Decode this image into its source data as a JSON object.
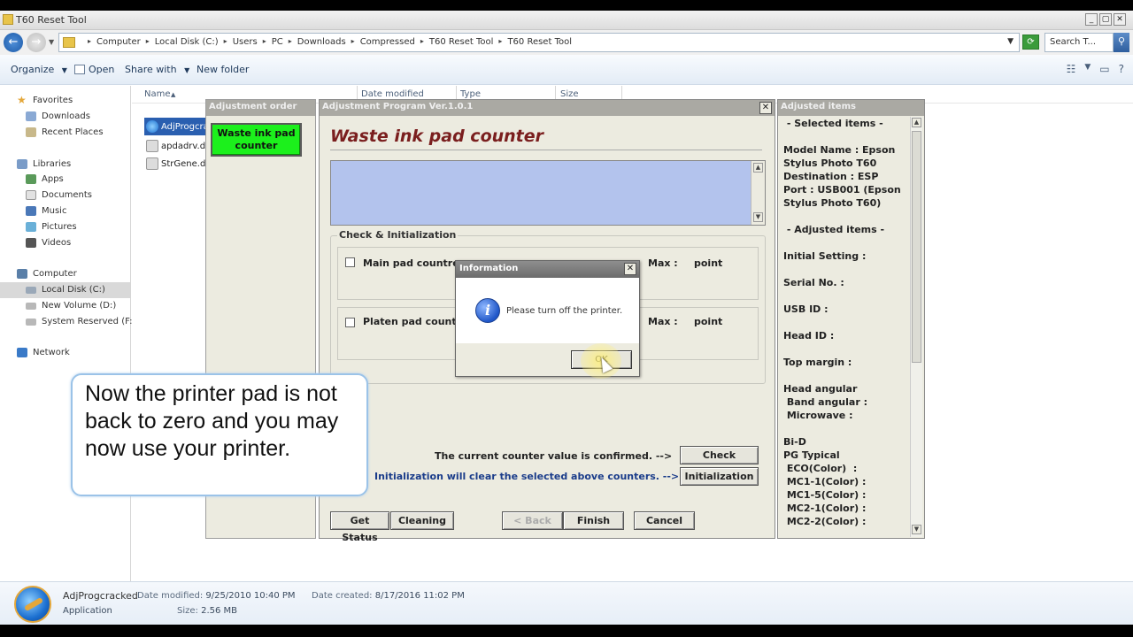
{
  "window": {
    "title": "T60 Reset Tool",
    "btn_min": "_",
    "btn_max": "▢",
    "btn_close": "✕"
  },
  "nav": {
    "back_glyph": "←",
    "forward_glyph": "→"
  },
  "address": {
    "crumbs": [
      "Computer",
      "Local Disk (C:)",
      "Users",
      "PC",
      "Downloads",
      "Compressed",
      "T60 Reset Tool",
      "T60 Reset Tool"
    ],
    "search_placeholder": "Search T...",
    "dropdown_glyph": "▼"
  },
  "toolbar": {
    "organize": "Organize",
    "open": "Open",
    "share_with": "Share with",
    "new_folder": "New folder",
    "dropdown_glyph": "▼"
  },
  "sidebar": {
    "favorites": "Favorites",
    "downloads": "Downloads",
    "recent_places": "Recent Places",
    "libraries": "Libraries",
    "apps": "Apps",
    "documents": "Documents",
    "music": "Music",
    "pictures": "Pictures",
    "videos": "Videos",
    "computer": "Computer",
    "local_disk": "Local Disk (C:)",
    "new_volume": "New Volume (D:)",
    "system_reserved": "System Reserved (F:)",
    "network": "Network"
  },
  "columns": {
    "name": "Name",
    "date_modified": "Date modified",
    "type": "Type",
    "size": "Size"
  },
  "files": [
    {
      "name": "AdjProgcra"
    },
    {
      "name": "apdadrv.d"
    },
    {
      "name": "StrGene.dl"
    }
  ],
  "details": {
    "file_name": "AdjProgcracked",
    "date_modified_label": "Date modified:",
    "date_modified": "9/25/2010 10:40 PM",
    "date_created_label": "Date created:",
    "date_created": "8/17/2016 11:02 PM",
    "type": "Application",
    "size_label": "Size:",
    "size": "2.56 MB"
  },
  "adjustment_order": {
    "title": "Adjustment order",
    "button": "Waste ink pad counter"
  },
  "adjustment_program": {
    "title": "Adjustment Program Ver.1.0.1",
    "heading": "Waste ink pad counter",
    "group_title": "Check & Initialization",
    "main_pad": "Main pad countre",
    "platen_pad": "Platen pad counte",
    "max_label": "Max :",
    "point_label": "point",
    "confirm_text": "The current counter value is confirmed. -->",
    "init_text": "Initialization will clear the selected above counters. -->",
    "check_button": "Check",
    "init_button": "Initialization",
    "get_status_button": "Get Status",
    "cleaning_button": "Cleaning",
    "back_button": "< Back",
    "finish_button": "Finish",
    "cancel_button": "Cancel",
    "close_glyph": "✕",
    "scroll_up": "▲",
    "scroll_down": "▼"
  },
  "adjusted_items": {
    "title": "Adjusted items",
    "text": " - Selected items -\n\nModel Name : Epson\nStylus Photo T60\nDestination : ESP\nPort : USB001 (Epson\nStylus Photo T60)\n\n - Adjusted items -\n\nInitial Setting :\n\nSerial No. :\n\nUSB ID :\n\nHead ID :\n\nTop margin :\n\nHead angular\n Band angular :\n Microwave :\n\nBi-D\nPG Typical\n ECO(Color)  :\n MC1-1(Color) :\n MC1-5(Color) :\n MC2-1(Color) :\n MC2-2(Color) :"
  },
  "info_dialog": {
    "title": "Information",
    "message": "Please turn off the printer.",
    "ok_button": "OK",
    "icon_glyph": "i",
    "close_glyph": "✕"
  },
  "callout": {
    "text": "Now the printer pad is not back to zero and you may now use your printer."
  }
}
